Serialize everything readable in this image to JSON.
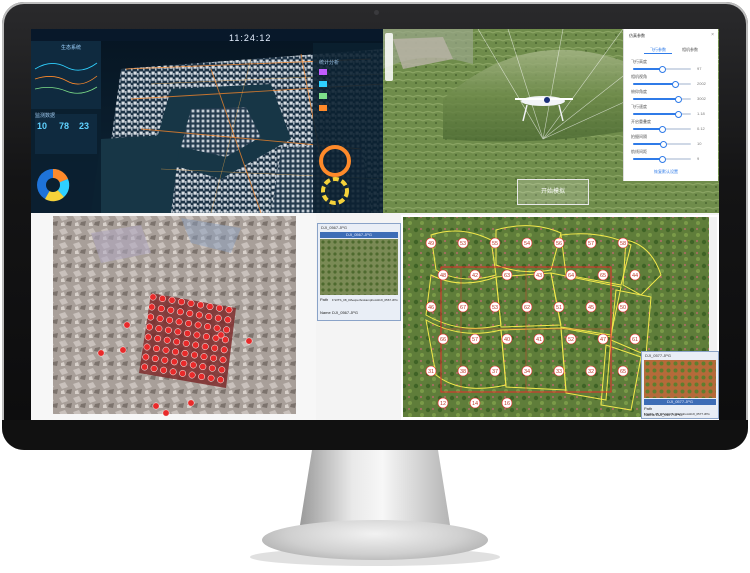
{
  "dashboard": {
    "time": "11:24:12",
    "title": "生态系统",
    "panel_titles": [
      "监测数据",
      "统计分析"
    ],
    "stat_values": [
      "10",
      "78",
      "23"
    ]
  },
  "flight_settings": {
    "title": "仿真参数",
    "close_label": "×",
    "tabs": [
      "飞行参数",
      "相机参数"
    ],
    "sliders": [
      {
        "label": "飞行高度",
        "value_text": "97",
        "fraction": 0.5
      },
      {
        "label": "相机视角",
        "value_text": "2002",
        "fraction": 0.72
      },
      {
        "label": "俯仰角度",
        "value_text": "3002",
        "fraction": 0.78
      },
      {
        "label": "飞行速度",
        "value_text": "1.18",
        "fraction": 0.78
      },
      {
        "label": "开启重叠度",
        "value_text": "0.12",
        "fraction": 0.5
      },
      {
        "label": "拍摄间隔",
        "value_text": "10",
        "fraction": 0.52
      },
      {
        "label": "航线间距",
        "value_text": "9",
        "fraction": 0.5
      }
    ],
    "reset_label": "恢复默认设置",
    "start_button": "开始模拟"
  },
  "photo_viewer_1": {
    "title": "DJI_0567.JPG",
    "header": "DJI_0567.JPG",
    "path_label": "Path",
    "path_value": "F:\\DTS_08_03\\expert\\rokamphoto\\DJI_0567.JPG",
    "name_label": "Name",
    "name_value": "DJI_0567.JPG"
  },
  "photo_viewer_2": {
    "title": "DJI_0577.JPG",
    "header": "DJI_0577.JPG",
    "path_label": "Path",
    "path_value": "F:\\DTS_08_03\\expert\\rokamphoto\\DJI_0577.JPG",
    "name_label": "Name",
    "name_value": "DJI_0577.JPG"
  },
  "parcel_labels": [
    "49",
    "53",
    "55",
    "54",
    "56",
    "57",
    "58",
    "48",
    "42",
    "63",
    "43",
    "64",
    "65",
    "44",
    "46",
    "67",
    "53",
    "62",
    "51",
    "45",
    "50",
    "66",
    "57",
    "40",
    "41",
    "52",
    "47",
    "61",
    "31",
    "38",
    "37",
    "34",
    "33",
    "32",
    "65",
    "12",
    "14",
    "16"
  ],
  "colors": {
    "dashboard_bg": "#0e2436",
    "accent_cyan": "#2fd0ff",
    "accent_orange": "#ff8a2a",
    "parcel_outline": "#f3e94a",
    "grid_red": "#e82a2a",
    "settings_blue": "#2f7be8"
  }
}
